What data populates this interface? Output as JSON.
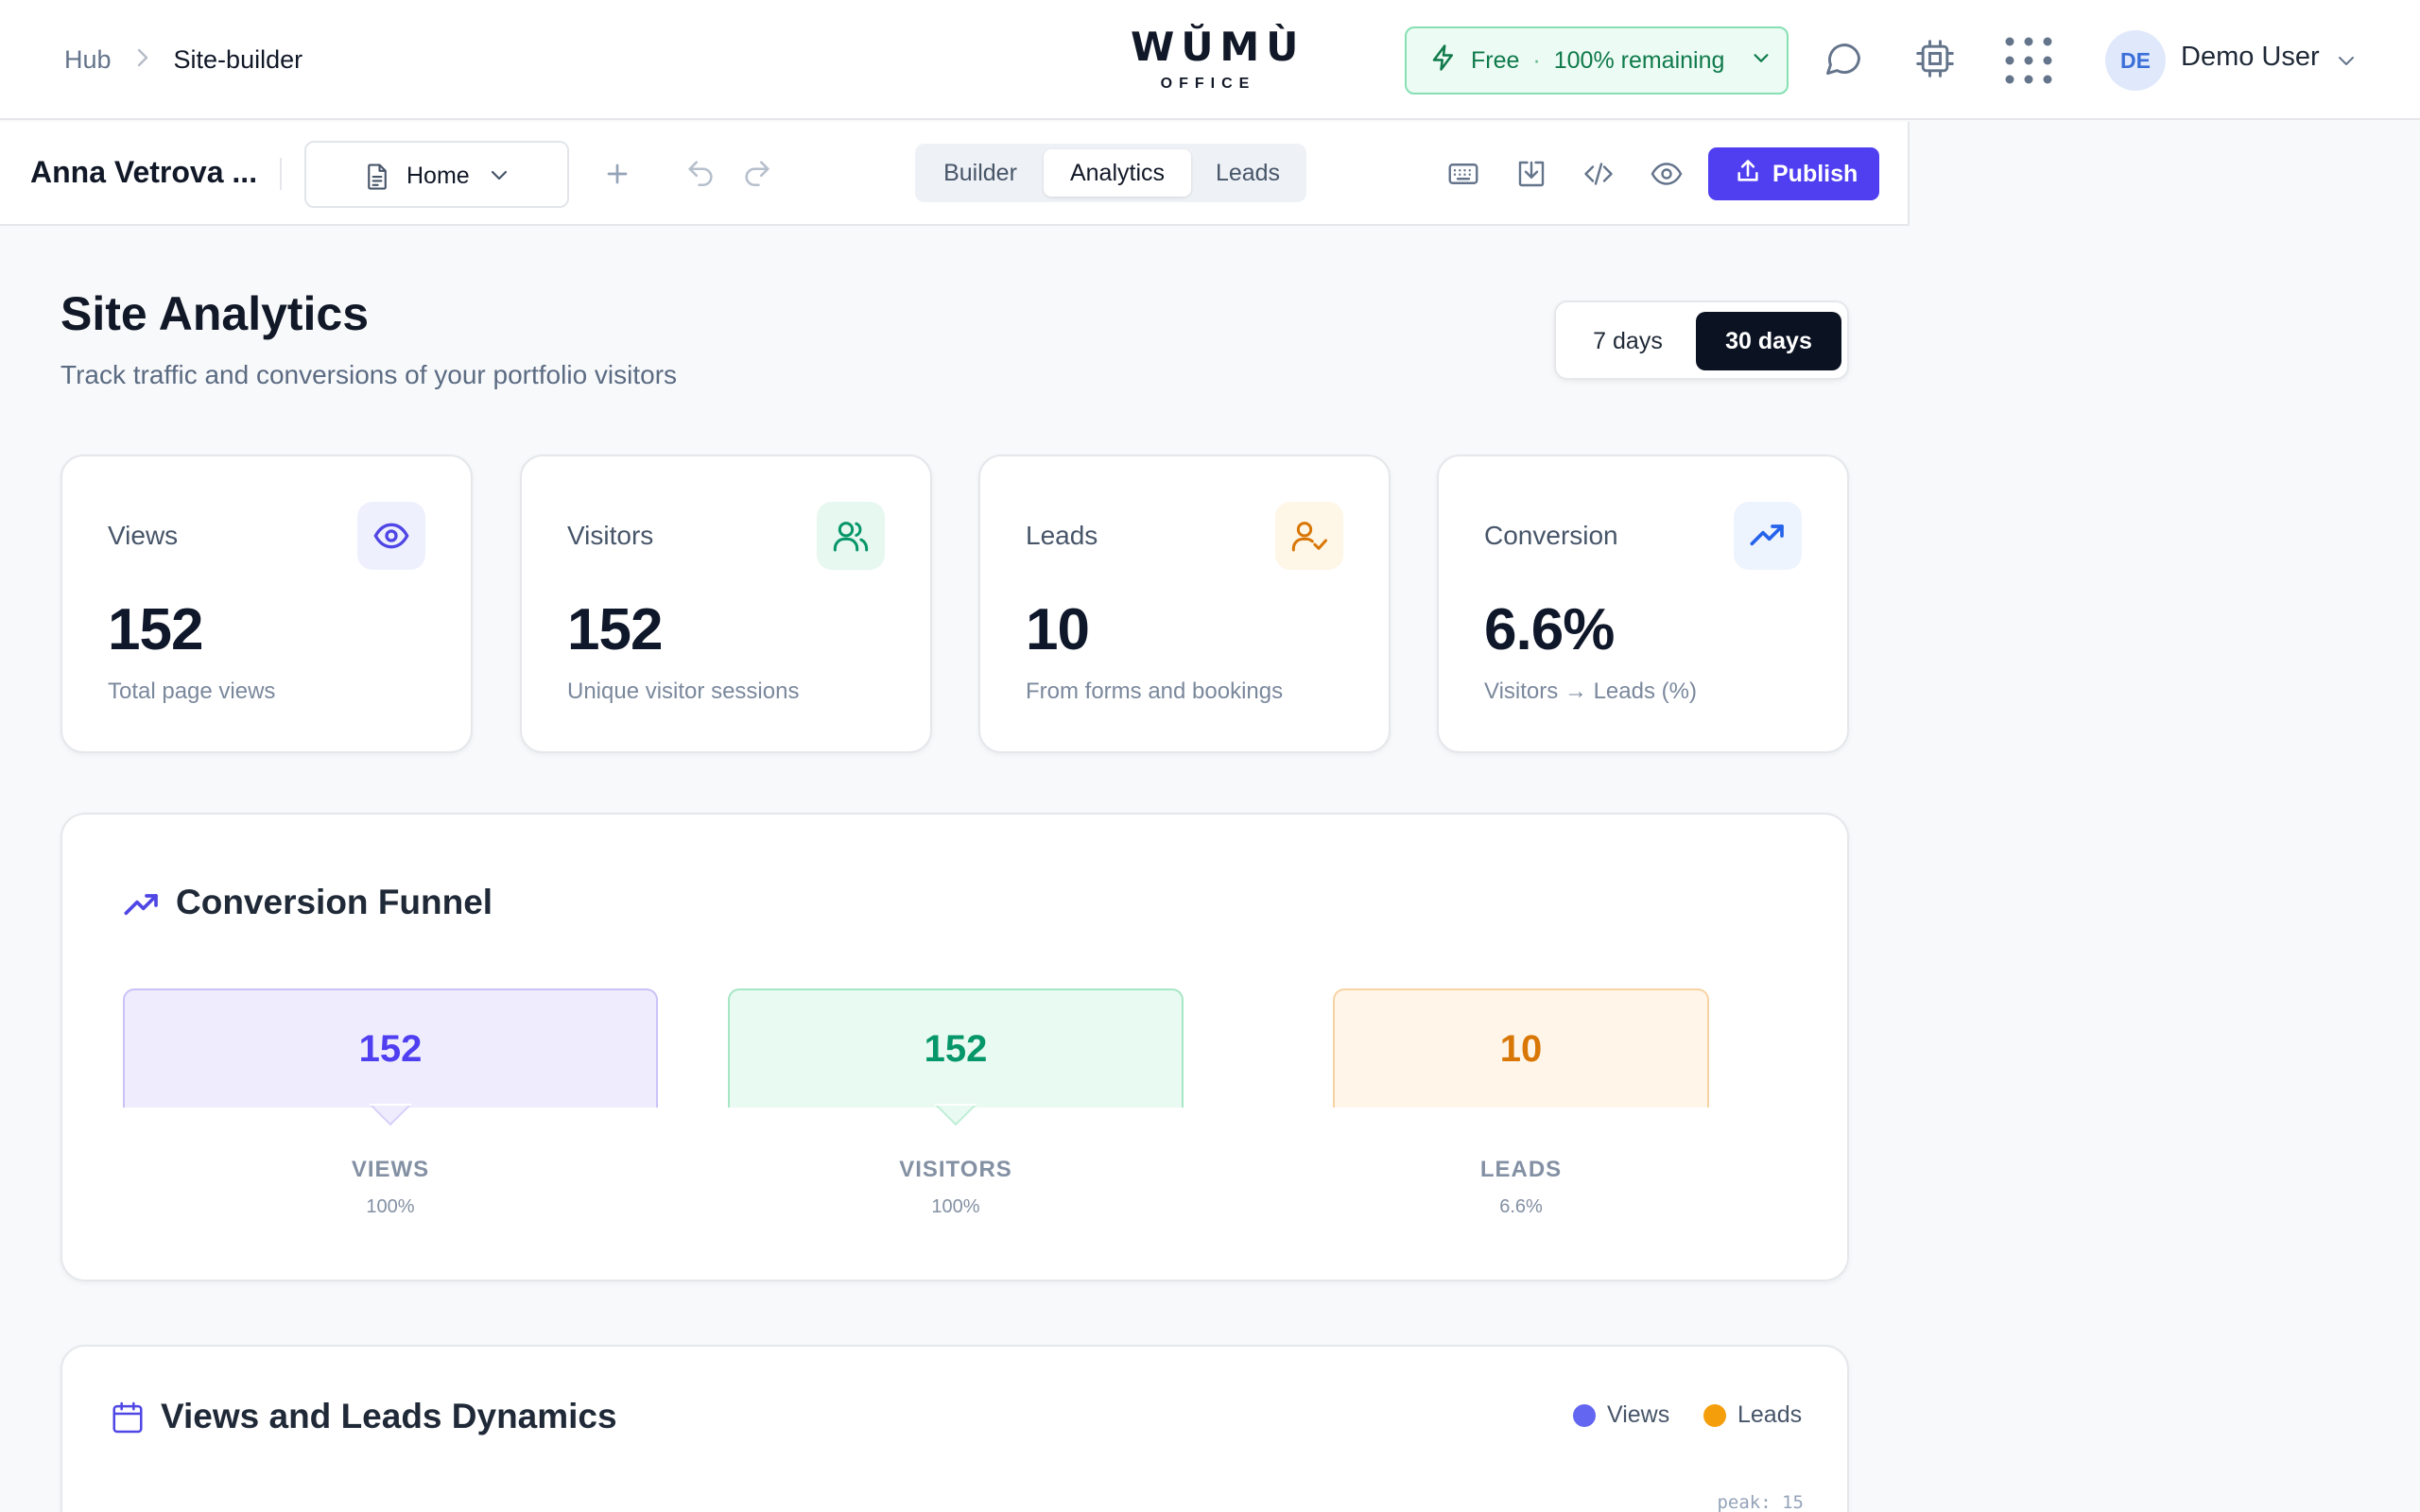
{
  "header": {
    "breadcrumb": {
      "root": "Hub",
      "current": "Site-builder"
    },
    "logo": {
      "word": "WŬMÙ",
      "sub": "OFFICE"
    },
    "plan": {
      "name": "Free",
      "separator": "·",
      "remaining": "100% remaining"
    },
    "user": {
      "initials": "DE",
      "name": "Demo User"
    }
  },
  "toolbar": {
    "site_name": "Anna Vetrova ...",
    "page_select": "Home",
    "tabs": [
      {
        "label": "Builder",
        "active": false
      },
      {
        "label": "Analytics",
        "active": true
      },
      {
        "label": "Leads",
        "active": false
      }
    ],
    "publish_label": "Publish"
  },
  "main": {
    "title": "Site Analytics",
    "subtitle": "Track traffic and conversions of your portfolio visitors",
    "range": {
      "option_7": "7 days",
      "option_30": "30 days",
      "selected": "30 days"
    },
    "stats": [
      {
        "label": "Views",
        "value": "152",
        "desc": "Total page views",
        "icon": "eye-icon",
        "color": "#4f46e5",
        "bg": "#eef0fe"
      },
      {
        "label": "Visitors",
        "value": "152",
        "desc": "Unique visitor sessions",
        "icon": "users-icon",
        "color": "#059669",
        "bg": "#e7f8f0"
      },
      {
        "label": "Leads",
        "value": "10",
        "desc": "From forms and bookings",
        "icon": "user-check-icon",
        "color": "#d97706",
        "bg": "#fef6e7"
      },
      {
        "label": "Conversion",
        "value": "6.6%",
        "desc": "Visitors → Leads (%)",
        "icon": "trending-up-icon",
        "color": "#2563eb",
        "bg": "#eef4fe"
      }
    ],
    "funnel": {
      "title": "Conversion Funnel",
      "steps": [
        {
          "value": "152",
          "label": "VIEWS",
          "pct": "100%",
          "color": "#4f3ff0",
          "bg": "#efedfd",
          "border": "#c9c2f8"
        },
        {
          "value": "152",
          "label": "VISITORS",
          "pct": "100%",
          "color": "#059669",
          "bg": "#e8faf1",
          "border": "#a7e6c6"
        },
        {
          "value": "10",
          "label": "LEADS",
          "pct": "6.6%",
          "color": "#d97706",
          "bg": "#fff5e9",
          "border": "#f7d3a3"
        }
      ]
    },
    "dynamics": {
      "title": "Views and Leads Dynamics",
      "legend": [
        {
          "label": "Views",
          "color": "#6366f1"
        },
        {
          "label": "Leads",
          "color": "#f59e0b"
        }
      ],
      "peak_label": "peak: 15"
    }
  }
}
